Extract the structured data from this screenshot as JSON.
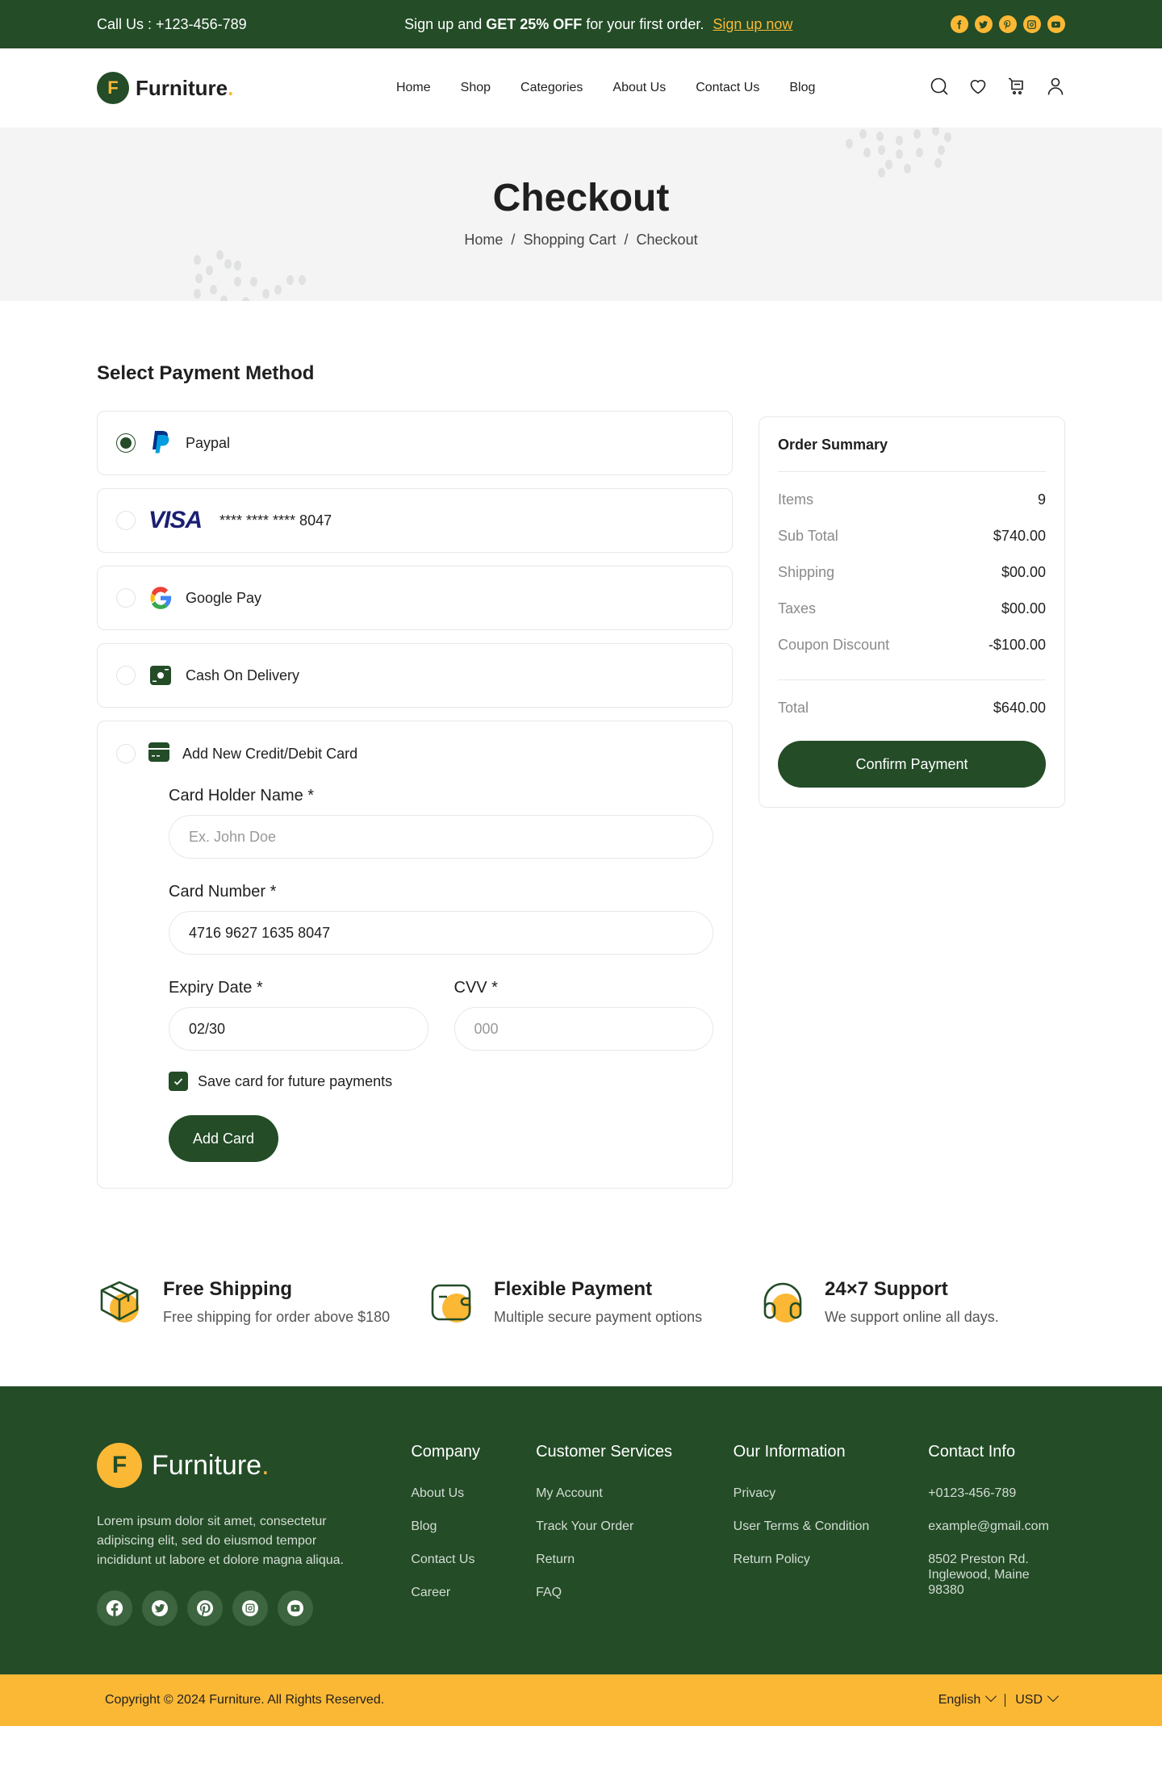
{
  "topbar": {
    "call_label": "Call Us :  +123-456-789",
    "promo_pre": "Sign up and ",
    "promo_bold": "GET 25% OFF",
    "promo_post": " for your first order.",
    "promo_link": "Sign up now",
    "social": [
      "facebook-icon",
      "twitter-icon",
      "pinterest-icon",
      "instagram-icon",
      "youtube-icon"
    ]
  },
  "header": {
    "logo_letter": "F",
    "logo_name": "Furniture",
    "logo_dot": ".",
    "nav": [
      "Home",
      "Shop",
      "Categories",
      "About Us",
      "Contact Us",
      "Blog"
    ],
    "icons": [
      "search-icon",
      "heart-icon",
      "cart-icon",
      "user-icon"
    ]
  },
  "hero": {
    "title": "Checkout",
    "breadcrumb": [
      "Home",
      "Shopping Cart",
      "Checkout"
    ],
    "separator": "/"
  },
  "payment": {
    "title": "Select Payment Method",
    "methods": [
      {
        "label": "Paypal",
        "icon": "paypal-icon",
        "selected": true
      },
      {
        "label": "**** **** **** 8047",
        "icon": "visa-icon",
        "brand": "VISA",
        "selected": false
      },
      {
        "label": "Google Pay",
        "icon": "google-icon",
        "selected": false
      },
      {
        "label": "Cash On Delivery",
        "icon": "cash-icon",
        "selected": false
      }
    ],
    "new_card": {
      "label": "Add New Credit/Debit Card",
      "icon": "credit-card-icon",
      "holder_label": "Card Holder Name *",
      "holder_placeholder": "Ex. John Doe",
      "number_label": "Card Number *",
      "number_value": "4716 9627 1635 8047",
      "expiry_label": "Expiry Date *",
      "expiry_value": "02/30",
      "cvv_label": "CVV *",
      "cvv_placeholder": "000",
      "save_label": "Save card for future payments",
      "save_checked": true,
      "button": "Add Card"
    }
  },
  "summary": {
    "title": "Order Summary",
    "rows": [
      {
        "label": "Items",
        "value": "9"
      },
      {
        "label": "Sub Total",
        "value": "$740.00"
      },
      {
        "label": "Shipping",
        "value": "$00.00"
      },
      {
        "label": "Taxes",
        "value": "$00.00"
      },
      {
        "label": "Coupon Discount",
        "value": "-$100.00"
      }
    ],
    "total_label": "Total",
    "total_value": "$640.00",
    "button": "Confirm Payment"
  },
  "features": [
    {
      "title": "Free Shipping",
      "text": "Free shipping for order above $180",
      "icon": "box-icon"
    },
    {
      "title": "Flexible Payment",
      "text": "Multiple secure payment options",
      "icon": "wallet-icon"
    },
    {
      "title": "24×7 Support",
      "text": "We support online all days.",
      "icon": "headphones-icon"
    }
  ],
  "footer": {
    "logo_letter": "F",
    "logo_name": "Furniture",
    "logo_dot": ".",
    "about": "Lorem ipsum dolor sit amet, consectetur adipiscing elit, sed do eiusmod tempor incididunt ut labore et dolore magna aliqua.",
    "columns": [
      {
        "title": "Company",
        "links": [
          "About Us",
          "Blog",
          "Contact Us",
          "Career"
        ]
      },
      {
        "title": "Customer Services",
        "links": [
          "My Account",
          "Track Your Order",
          "Return",
          "FAQ"
        ]
      },
      {
        "title": "Our Information",
        "links": [
          "Privacy",
          "User Terms & Condition",
          "Return Policy"
        ]
      },
      {
        "title": "Contact Info",
        "links": [
          "+0123-456-789",
          "example@gmail.com",
          "8502 Preston Rd. Inglewood, Maine 98380"
        ]
      }
    ],
    "copyright": "Copyright © 2024 Furniture. All Rights Reserved.",
    "language": "English",
    "currency": "USD"
  },
  "colors": {
    "brand_green": "#234c27",
    "accent_yellow": "#fbb835"
  }
}
